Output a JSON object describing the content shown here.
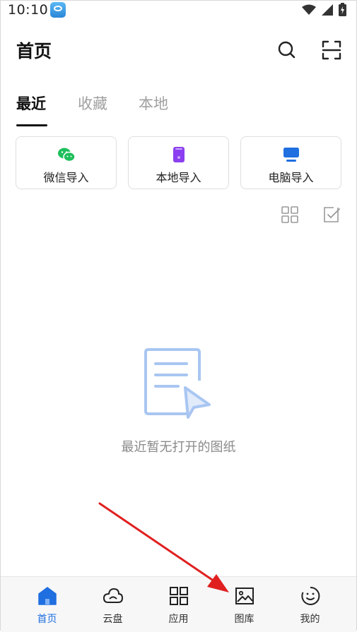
{
  "status_bar": {
    "time": "10:10"
  },
  "header": {
    "title": "首页"
  },
  "tabs": [
    {
      "label": "最近",
      "active": true
    },
    {
      "label": "收藏",
      "active": false
    },
    {
      "label": "本地",
      "active": false
    }
  ],
  "import_cards": [
    {
      "label": "微信导入",
      "icon": "wechat-icon",
      "color": "#1fbf5c"
    },
    {
      "label": "本地导入",
      "icon": "phone-icon",
      "color": "#8b3ff0"
    },
    {
      "label": "电脑导入",
      "icon": "monitor-icon",
      "color": "#1f6fe0"
    }
  ],
  "empty_state": {
    "text": "最近暂无打开的图纸"
  },
  "bottom_nav": [
    {
      "label": "首页",
      "icon": "home-icon",
      "active": true
    },
    {
      "label": "云盘",
      "icon": "cloud-icon",
      "active": false
    },
    {
      "label": "应用",
      "icon": "apps-grid-icon",
      "active": false
    },
    {
      "label": "图库",
      "icon": "gallery-icon",
      "active": false
    },
    {
      "label": "我的",
      "icon": "profile-icon",
      "active": false
    }
  ],
  "colors": {
    "accent": "#1f6fe0",
    "annotation_arrow": "#e02020"
  }
}
